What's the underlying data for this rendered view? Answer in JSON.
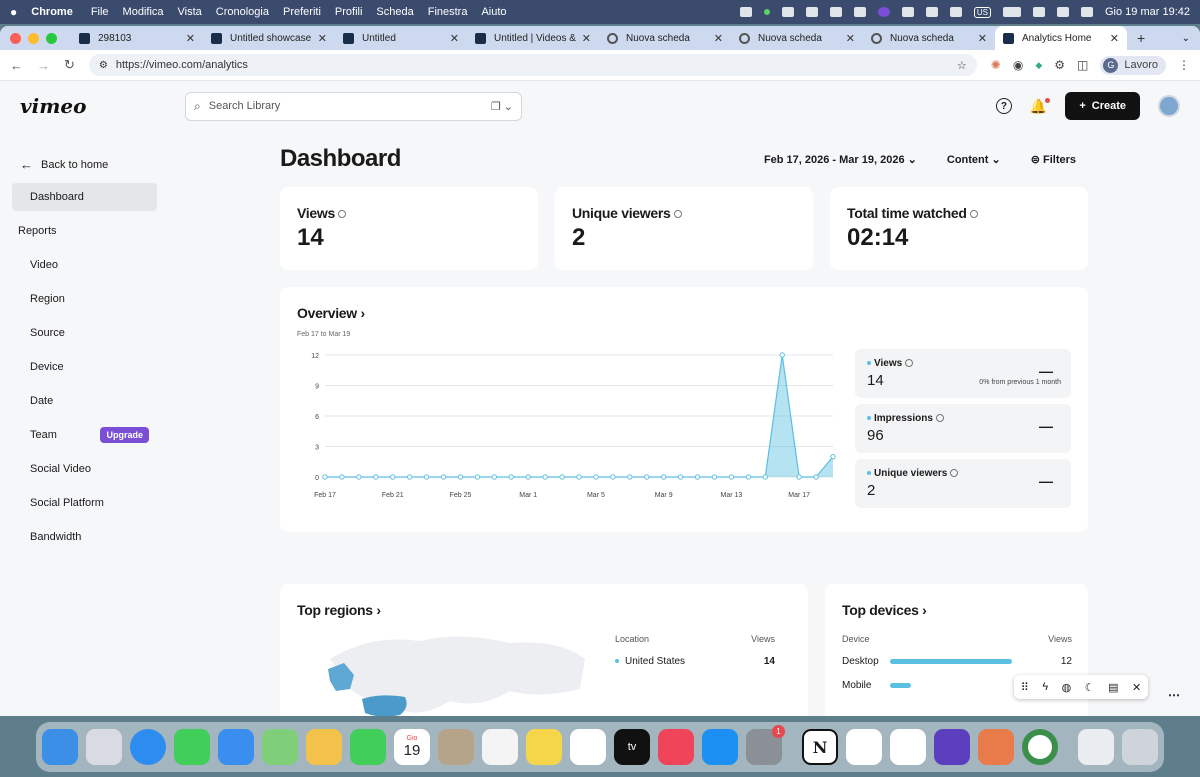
{
  "menubar": {
    "apple": "",
    "app": "Chrome",
    "items": [
      "File",
      "Modifica",
      "Vista",
      "Cronologia",
      "Preferiti",
      "Profili",
      "Scheda",
      "Finestra",
      "Aiuto"
    ],
    "ime": "US",
    "clock": "Gio 19 mar  19:42"
  },
  "tabs": [
    {
      "title": "298103",
      "favicon": "vimeo"
    },
    {
      "title": "Untitled showcase o",
      "favicon": "vimeo"
    },
    {
      "title": "Untitled",
      "favicon": "vimeo"
    },
    {
      "title": "Untitled | Videos & M",
      "favicon": "vimeo"
    },
    {
      "title": "Nuova scheda",
      "favicon": "chrome"
    },
    {
      "title": "Nuova scheda",
      "favicon": "chrome"
    },
    {
      "title": "Nuova scheda",
      "favicon": "chrome"
    },
    {
      "title": "Analytics Home",
      "favicon": "vimeo",
      "active": true
    }
  ],
  "address": {
    "url": "https://vimeo.com/analytics",
    "profile_initial": "G",
    "profile_label": "Lavoro"
  },
  "header": {
    "logo": "vimeo",
    "search_placeholder": "Search Library",
    "create_label": "Create",
    "help_glyph": "?"
  },
  "sidebar": {
    "back_label": "Back to home",
    "items": [
      {
        "label": "Dashboard",
        "selected": true
      },
      {
        "label": "Reports"
      },
      {
        "label": "Video"
      },
      {
        "label": "Region"
      },
      {
        "label": "Source"
      },
      {
        "label": "Device"
      },
      {
        "label": "Date"
      },
      {
        "label": "Team",
        "badge": "Upgrade"
      },
      {
        "label": "Social Video"
      },
      {
        "label": "Social Platform"
      },
      {
        "label": "Bandwidth"
      }
    ]
  },
  "dashboard": {
    "title": "Dashboard",
    "date_range": "Feb 17, 2026 - Mar 19, 2026",
    "content_label": "Content",
    "filters_label": "Filters",
    "stats": [
      {
        "label": "Views",
        "value": "14"
      },
      {
        "label": "Unique viewers",
        "value": "2"
      },
      {
        "label": "Total time watched",
        "value": "02:14"
      }
    ]
  },
  "overview": {
    "title": "Overview",
    "subtitle": "Feb 17 to Mar 19",
    "metrics": [
      {
        "label": "Views",
        "value": "14",
        "change": "0% from previous 1 month",
        "dash": "—"
      },
      {
        "label": "Impressions",
        "value": "96",
        "dash": "—"
      },
      {
        "label": "Unique viewers",
        "value": "2",
        "dash": "—"
      }
    ]
  },
  "chart_data": {
    "type": "area",
    "x": [
      "Feb 17",
      "Feb 18",
      "Feb 19",
      "Feb 20",
      "Feb 21",
      "Feb 22",
      "Feb 23",
      "Feb 24",
      "Feb 25",
      "Feb 26",
      "Feb 27",
      "Feb 28",
      "Mar 1",
      "Mar 2",
      "Mar 3",
      "Mar 4",
      "Mar 5",
      "Mar 6",
      "Mar 7",
      "Mar 8",
      "Mar 9",
      "Mar 10",
      "Mar 11",
      "Mar 12",
      "Mar 13",
      "Mar 14",
      "Mar 15",
      "Mar 16",
      "Mar 17",
      "Mar 18",
      "Mar 19"
    ],
    "x_ticks": [
      "Feb 17",
      "Feb 21",
      "Feb 25",
      "Mar 1",
      "Mar 5",
      "Mar 9",
      "Mar 13",
      "Mar 17"
    ],
    "series": [
      {
        "name": "Views",
        "values": [
          0,
          0,
          0,
          0,
          0,
          0,
          0,
          0,
          0,
          0,
          0,
          0,
          0,
          0,
          0,
          0,
          0,
          0,
          0,
          0,
          0,
          0,
          0,
          0,
          0,
          0,
          0,
          12,
          0,
          0,
          2
        ]
      }
    ],
    "yticks": [
      0,
      3,
      6,
      9,
      12
    ],
    "ylim": [
      0,
      12
    ],
    "grid": true,
    "color": "#5bc0e0"
  },
  "regions": {
    "title": "Top regions",
    "col_location": "Location",
    "col_views": "Views",
    "rows": [
      {
        "location": "United States",
        "views": "14"
      }
    ]
  },
  "devices": {
    "title": "Top devices",
    "col_device": "Device",
    "col_views": "Views",
    "rows": [
      {
        "device": "Desktop",
        "views": "12",
        "fraction": 1.0
      },
      {
        "device": "Mobile",
        "views": "2",
        "fraction": 0.17
      }
    ]
  },
  "colors": {
    "accent": "#5bc0e0",
    "upgrade": "#7a4fd6",
    "create": "#111111"
  },
  "dock_apps": [
    "Finder",
    "Launchpad",
    "Safari",
    "Messages",
    "Mail",
    "Maps",
    "Photos",
    "FaceTime",
    "Calendar",
    "Contacts",
    "Reminders",
    "Notes",
    "Freeform",
    "TV",
    "Music",
    "App Store",
    "System Settings",
    "Notion",
    "Asana",
    "Slack",
    "Proton VPN",
    "Claude",
    "Chrome",
    "Preview",
    "Trash"
  ],
  "dock_calendar": {
    "month": "Gio",
    "day": "19"
  },
  "dock_tv_label": "tv",
  "dock_notion_label": "N"
}
